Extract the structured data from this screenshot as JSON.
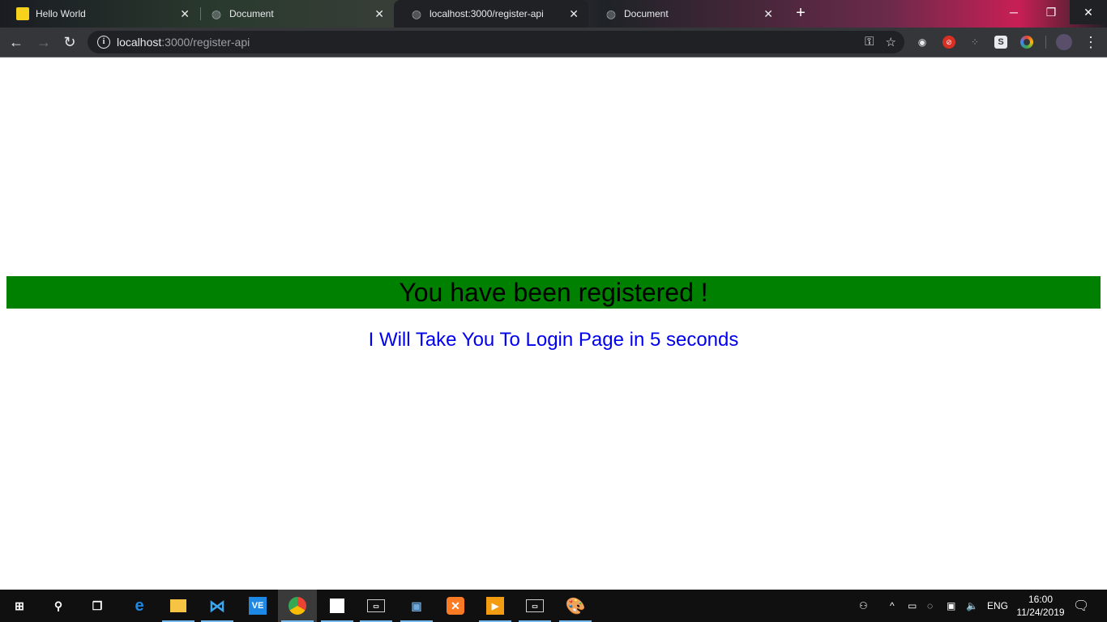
{
  "browser": {
    "tabs": [
      {
        "title": "Hello World",
        "favicon": "yellow-app-icon",
        "active": false
      },
      {
        "title": "Document",
        "favicon": "globe-icon",
        "active": false
      },
      {
        "title": "localhost:3000/register-api",
        "favicon": "globe-icon",
        "active": true
      },
      {
        "title": "Document",
        "favicon": "globe-icon",
        "active": false
      }
    ],
    "url_host": "localhost",
    "url_path": ":3000/register-api",
    "theme_accent": "#c81f55"
  },
  "page": {
    "banner_text": "You have been registered !",
    "banner_color": "#008000",
    "redirect_text": "I Will Take You To Login Page in 5 seconds",
    "redirect_color": "#0000ee"
  },
  "taskbar": {
    "apps": [
      "start",
      "search",
      "task-view",
      "edge",
      "file-explorer",
      "vscode",
      "vnc-viewer",
      "chrome",
      "sticky-notes",
      "terminal",
      "network-tool",
      "xampp",
      "media-player",
      "terminal",
      "paint"
    ],
    "language": "ENG",
    "time": "16:00",
    "date": "11/24/2019"
  }
}
